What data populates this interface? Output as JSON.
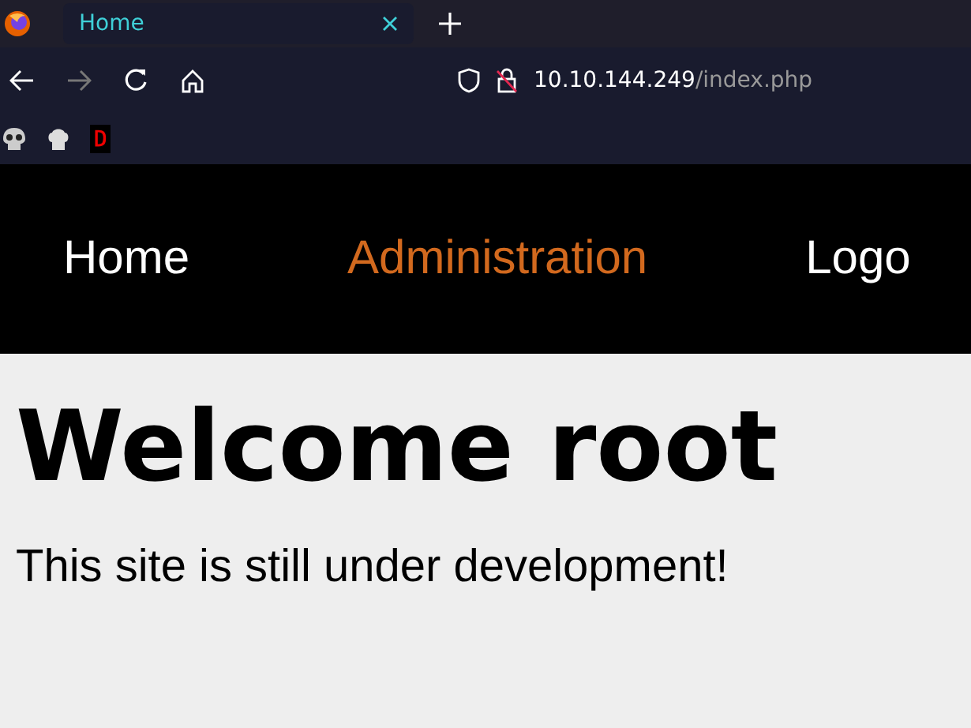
{
  "browser": {
    "tabs": [
      {
        "title": "Home",
        "selected": true
      }
    ],
    "url_host": "10.10.144.249",
    "url_path": "/index.php",
    "bookmarks": [
      {
        "kind": "skull"
      },
      {
        "kind": "chef"
      },
      {
        "kind": "letter",
        "text": "D"
      }
    ]
  },
  "nav": [
    {
      "label": "Home",
      "selected": false
    },
    {
      "label": "Administration",
      "selected": true
    },
    {
      "label": "Logo",
      "selected": false
    }
  ],
  "heading": "Welcome root",
  "message": "This site is still under development!"
}
